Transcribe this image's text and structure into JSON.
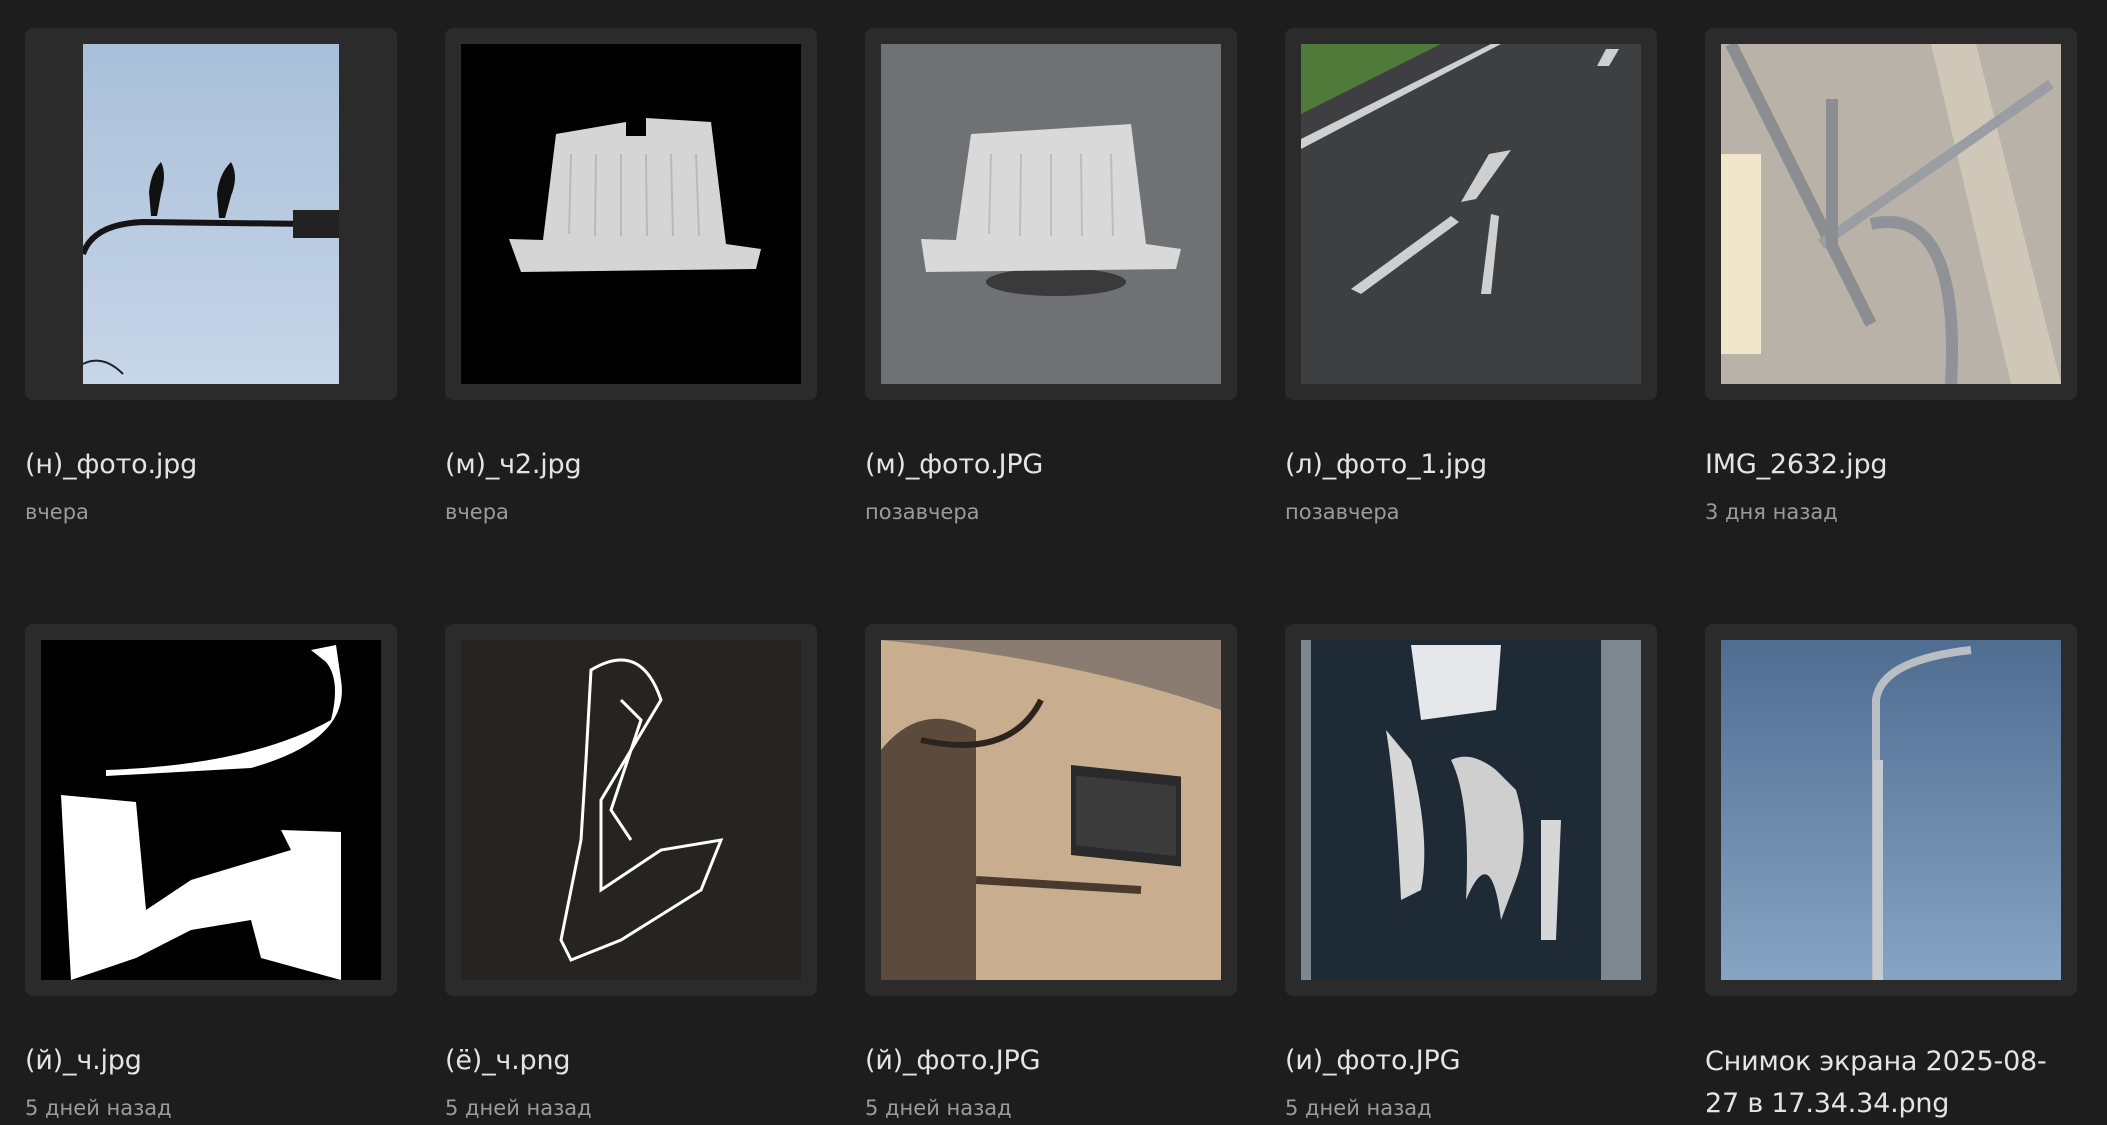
{
  "files": [
    {
      "name": "(н)_фото.jpg",
      "date": "вчера"
    },
    {
      "name": "(м)_ч2.jpg",
      "date": "вчера"
    },
    {
      "name": "(м)_фото.JPG",
      "date": "позавчера"
    },
    {
      "name": "(л)_фото_1.jpg",
      "date": "позавчера"
    },
    {
      "name": "IMG_2632.jpg",
      "date": "3 дня назад"
    },
    {
      "name": "(й)_ч.jpg",
      "date": "5 дней назад"
    },
    {
      "name": "(ё)_ч.png",
      "date": "5 дней назад"
    },
    {
      "name": "(й)_фото.JPG",
      "date": "5 дней назад"
    },
    {
      "name": "(и)_фото.JPG",
      "date": "5 дней назад"
    },
    {
      "name": "Снимок экрана 2025-08-27 в 17.34.34.png",
      "date": ""
    }
  ]
}
